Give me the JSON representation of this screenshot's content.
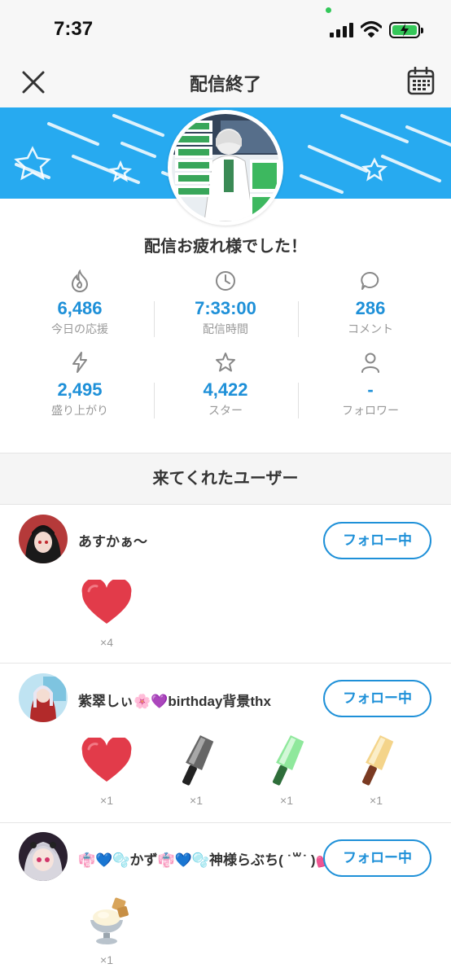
{
  "status": {
    "time": "7:37"
  },
  "nav": {
    "title": "配信終了"
  },
  "thanks": "配信お疲れ様でした！",
  "stats": [
    {
      "icon": "fire-icon",
      "value": "6,486",
      "label": "今日の応援"
    },
    {
      "icon": "clock-icon",
      "value": "7:33:00",
      "label": "配信時間"
    },
    {
      "icon": "comment-icon",
      "value": "286",
      "label": "コメント"
    },
    {
      "icon": "lightning-icon",
      "value": "2,495",
      "label": "盛り上がり"
    },
    {
      "icon": "star-icon",
      "value": "4,422",
      "label": "スター"
    },
    {
      "icon": "person-icon",
      "value": "-",
      "label": "フォロワー"
    }
  ],
  "section": {
    "title": "来てくれたユーザー"
  },
  "users": [
    {
      "name": "あすかぁ〜",
      "follow_label": "フォロー中",
      "gifts": [
        {
          "icon": "heart-icon",
          "count": "×4"
        }
      ]
    },
    {
      "name": "紫翠しぃ🌸💜birthday背景thx",
      "follow_label": "フォロー中",
      "gifts": [
        {
          "icon": "heart-icon",
          "count": "×1"
        },
        {
          "icon": "black-penlight-icon",
          "count": "×1"
        },
        {
          "icon": "green-penlight-icon",
          "count": "×1"
        },
        {
          "icon": "yellow-penlight-icon",
          "count": "×1"
        }
      ]
    },
    {
      "name": "👘💙🫧かず👘💙🫧神様らぶち( ˙꒳˙ )💕",
      "follow_label": "フォロー中",
      "gifts": [
        {
          "icon": "ice-cream-icon",
          "count": "×1"
        }
      ]
    }
  ],
  "colors": {
    "accent": "#1e90d8",
    "banner": "#27aaf0",
    "heart": "#e23b4a"
  }
}
